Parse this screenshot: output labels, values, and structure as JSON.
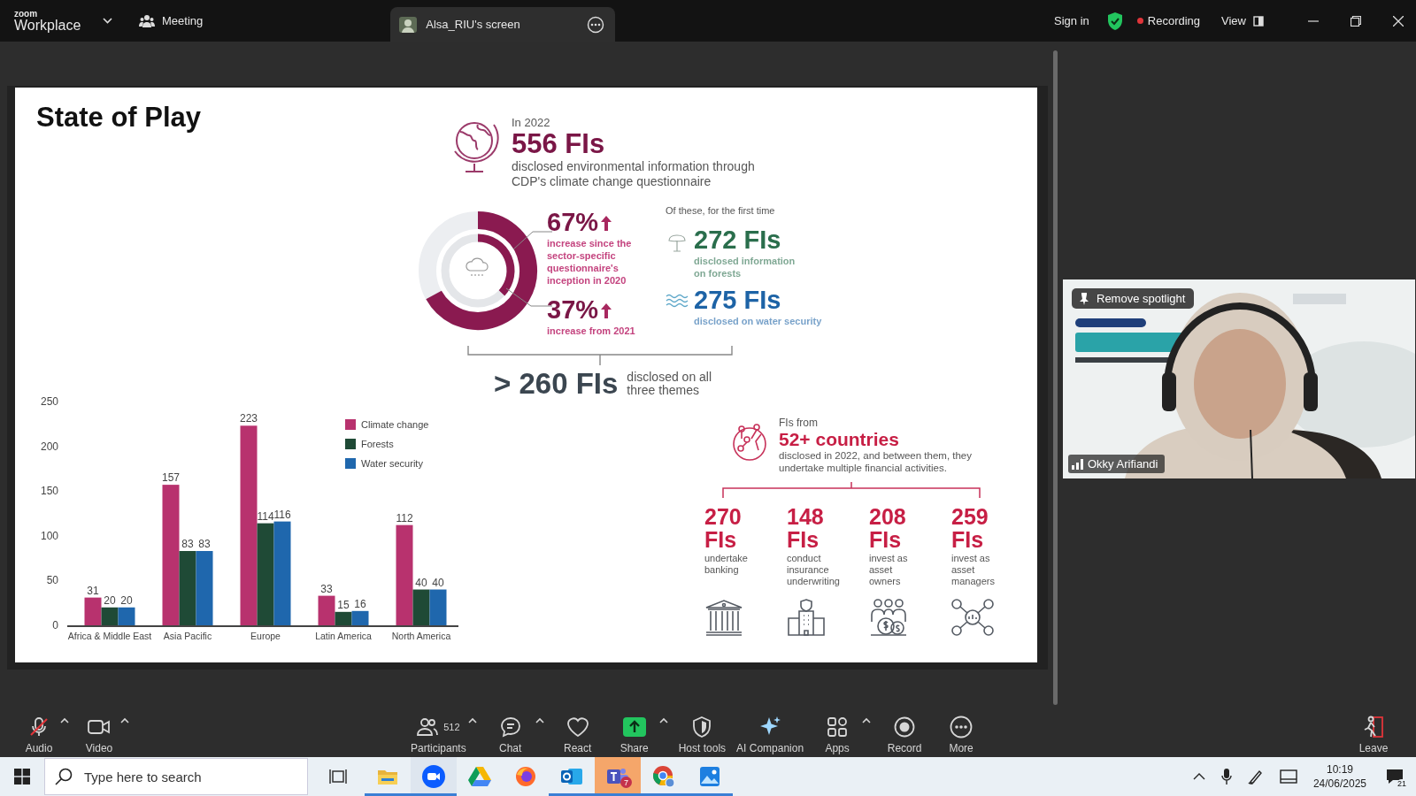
{
  "app": {
    "logo_top": "zoom",
    "logo": "Workplace",
    "meeting": "Meeting",
    "share_tab": "Alsa_RIU's screen",
    "sign_in": "Sign in",
    "recording": "Recording",
    "view": "View"
  },
  "slide": {
    "title": "State of Play",
    "intro": {
      "year": "In 2022",
      "headline": "556 FIs",
      "text": "disclosed environmental information through CDP's climate change questionnaire"
    },
    "increases": [
      {
        "value": "67%",
        "text": "increase since the\nsector-specific\nquestionnaire's\ninception in 2020"
      },
      {
        "value": "37%",
        "text": "increase from 2021"
      }
    ],
    "first_time": {
      "label": "Of these, for the first time",
      "items": [
        {
          "kind": "forest",
          "value": "272 FIs",
          "text": "disclosed information\non forests",
          "color": "#2a6e4c"
        },
        {
          "kind": "water",
          "value": "275 FIs",
          "text": "disclosed on water security",
          "color": "#1d63a6"
        }
      ]
    },
    "all_themes": {
      "value": "> 260 FIs",
      "text": "disclosed on all\nthree themes"
    },
    "countries": {
      "label": "FIs from",
      "headline": "52+ countries",
      "text": "disclosed in 2022, and between them, they\nundertake multiple financial activities."
    },
    "activities": [
      {
        "kind": "bank",
        "value": "270\nFIs",
        "text": "undertake\nbanking"
      },
      {
        "kind": "insurance",
        "value": "148\nFIs",
        "text": "conduct\ninsurance\nunderwriting"
      },
      {
        "kind": "owners",
        "value": "208\nFIs",
        "text": "invest as\nasset\nowners"
      },
      {
        "kind": "managers",
        "value": "259\nFIs",
        "text": "invest as\nasset\nmanagers"
      }
    ],
    "chart_data": {
      "type": "bar",
      "categories": [
        "Africa & Middle East",
        "Asia Pacific",
        "Europe",
        "Latin America",
        "North America"
      ],
      "series": [
        {
          "name": "Climate change",
          "color": "#b8326e",
          "values": [
            31,
            157,
            223,
            33,
            112
          ]
        },
        {
          "name": "Forests",
          "color": "#1f4a36",
          "values": [
            20,
            83,
            114,
            15,
            40
          ]
        },
        {
          "name": "Water security",
          "color": "#1f67ad",
          "values": [
            20,
            83,
            116,
            16,
            40
          ]
        }
      ],
      "legend": "upper right",
      "ylim": [
        0,
        250
      ],
      "yticks": [
        0,
        50,
        100,
        150,
        200,
        250
      ],
      "data_labels": true
    }
  },
  "video": {
    "spotlight_button": "Remove spotlight",
    "participant": "Okky Arifiandi"
  },
  "toolbar": [
    {
      "kind": "audio",
      "label": "Audio",
      "muted": true,
      "caret": true
    },
    {
      "kind": "video",
      "label": "Video",
      "caret": true
    },
    {
      "kind": "participants",
      "label": "Participants",
      "count": "512",
      "caret": true
    },
    {
      "kind": "chat",
      "label": "Chat",
      "caret": true
    },
    {
      "kind": "react",
      "label": "React",
      "caret": false
    },
    {
      "kind": "share",
      "label": "Share",
      "caret": true
    },
    {
      "kind": "host",
      "label": "Host tools",
      "caret": false
    },
    {
      "kind": "ai",
      "label": "AI Companion",
      "caret": false
    },
    {
      "kind": "apps",
      "label": "Apps",
      "caret": true
    },
    {
      "kind": "record",
      "label": "Record",
      "caret": false
    },
    {
      "kind": "more",
      "label": "More",
      "caret": false
    },
    {
      "kind": "leave",
      "label": "Leave",
      "caret": false
    }
  ],
  "taskbar": {
    "search_placeholder": "Type here to search",
    "apps": [
      {
        "kind": "explorer",
        "running": true,
        "selected": false
      },
      {
        "kind": "zoom",
        "running": true,
        "selected": true
      },
      {
        "kind": "drive",
        "running": false,
        "selected": false
      },
      {
        "kind": "firefox",
        "running": false,
        "selected": false
      },
      {
        "kind": "outlook",
        "running": true,
        "selected": false
      },
      {
        "kind": "teams",
        "running": true,
        "selected": false,
        "badge": "7"
      },
      {
        "kind": "chrome",
        "running": true,
        "selected": false
      },
      {
        "kind": "photos",
        "running": true,
        "selected": false
      }
    ],
    "time": "10:19",
    "date": "24/06/2025",
    "notifications": "21"
  }
}
